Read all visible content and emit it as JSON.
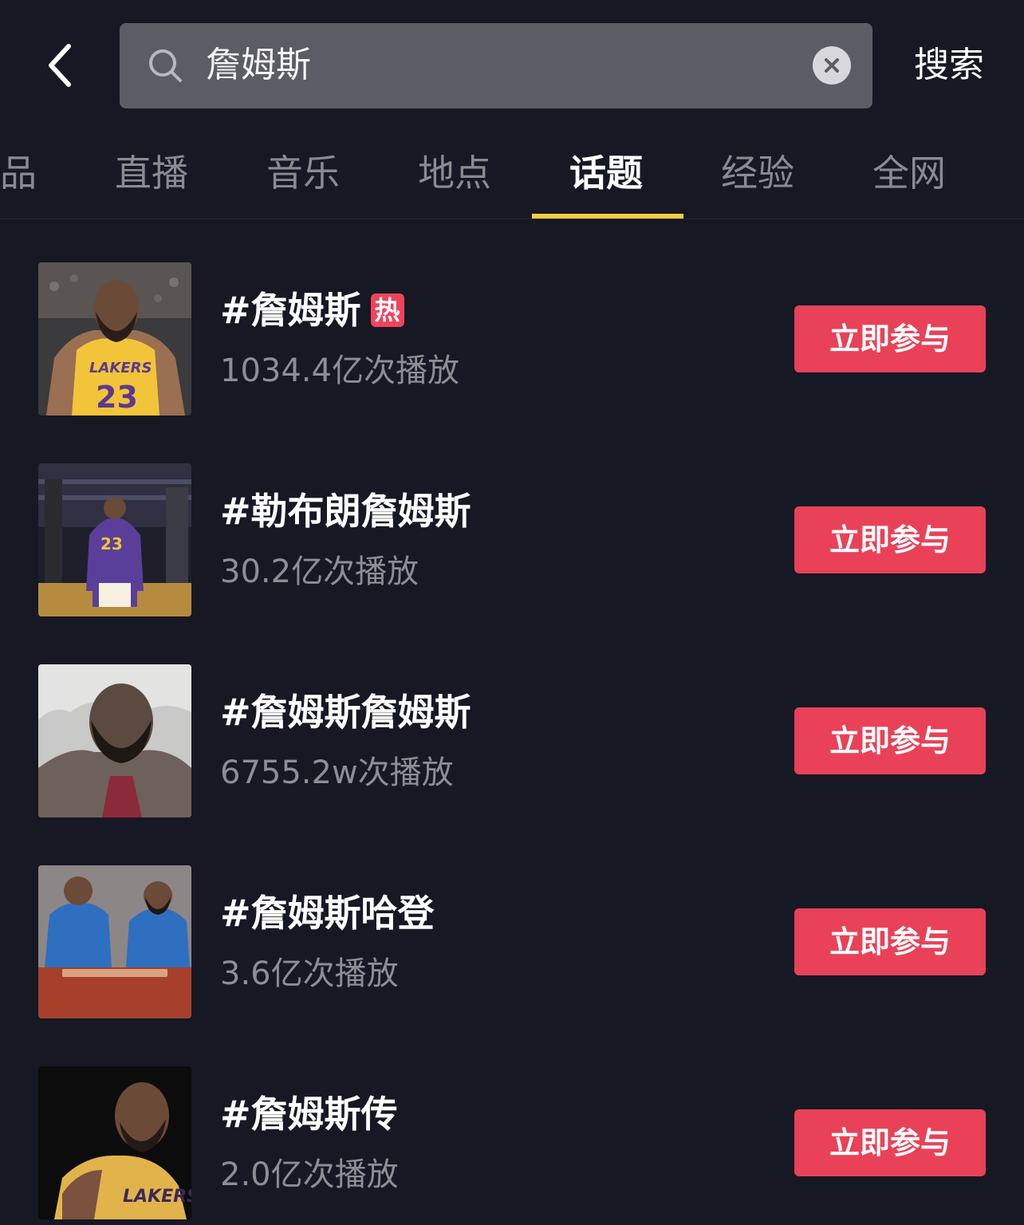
{
  "header": {
    "search_value": "詹姆斯",
    "search_button_label": "搜索"
  },
  "tabs": [
    {
      "label": "品"
    },
    {
      "label": "直播"
    },
    {
      "label": "音乐"
    },
    {
      "label": "地点"
    },
    {
      "label": "话题",
      "active": true
    },
    {
      "label": "经验"
    },
    {
      "label": "全网"
    }
  ],
  "topics": [
    {
      "title": "#詹姆斯",
      "hot_badge": "热",
      "plays": "1034.4亿次播放",
      "join_label": "立即参与"
    },
    {
      "title": "#勒布朗詹姆斯",
      "plays": "30.2亿次播放",
      "join_label": "立即参与"
    },
    {
      "title": "#詹姆斯詹姆斯",
      "plays": "6755.2w次播放",
      "join_label": "立即参与"
    },
    {
      "title": "#詹姆斯哈登",
      "plays": "3.6亿次播放",
      "join_label": "立即参与"
    },
    {
      "title": "#詹姆斯传",
      "plays": "2.0亿次播放",
      "join_label": "立即参与"
    }
  ],
  "colors": {
    "background": "#161823",
    "accent_underline": "#facd3f",
    "join_button": "#e94158",
    "hot_badge": "#f0435c"
  },
  "icons": {
    "back": "chevron-left-icon",
    "search": "search-icon",
    "clear": "close-icon"
  }
}
